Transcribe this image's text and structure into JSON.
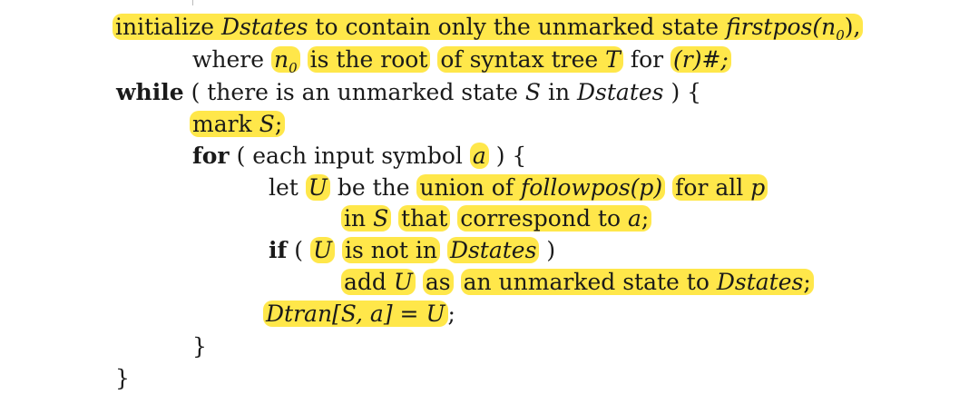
{
  "algorithm": {
    "line1": {
      "t1": "initialize",
      "t2": "Dstates",
      "t3": "to contain only the unmarked state",
      "t4": "firstpos(n",
      "t5": "0",
      "t6": "),"
    },
    "line2": {
      "t1": "where",
      "t2": "n",
      "t3": "0",
      "t4": "is the root",
      "t5": "of syntax tree",
      "t6": "T",
      "t7": "for",
      "t8": "(r)#;"
    },
    "line3": {
      "kw": "while",
      "t1": "( there is an unmarked state",
      "t2": "S",
      "t3": "in",
      "t4": "Dstates",
      "t5": ") {"
    },
    "line4": {
      "t1": "mark",
      "t2": "S",
      "t3": ";"
    },
    "line5": {
      "kw": "for",
      "t1": "( each input symbol",
      "t2": "a",
      "t3": ") {"
    },
    "line6": {
      "t1": "let",
      "t2": "U",
      "t3": "be the",
      "t4": "union of",
      "t5": "followpos",
      "t6": "(p)",
      "t7": "for all",
      "t8": "p"
    },
    "line7": {
      "t1": "in",
      "t2": "S",
      "t3": "that",
      "t4": "correspond to",
      "t5": "a",
      "t6": ";"
    },
    "line8": {
      "kw": "if",
      "t1": "(",
      "t2": "U",
      "t3": "is not in",
      "t4": "Dstates",
      "t5": ")"
    },
    "line9": {
      "t1": "add",
      "t2": "U",
      "t3": "as",
      "t4": "an unmarked state to",
      "t5": "Dstates",
      "t6": ";"
    },
    "line10": {
      "t1": "Dtran[S, a]",
      "t2": "=",
      "t3": "U",
      "t4": ";"
    },
    "line11": {
      "t1": "}"
    },
    "line12": {
      "t1": "}"
    }
  },
  "colors": {
    "highlight": "#ffe74a",
    "text": "#1a1a1a"
  }
}
